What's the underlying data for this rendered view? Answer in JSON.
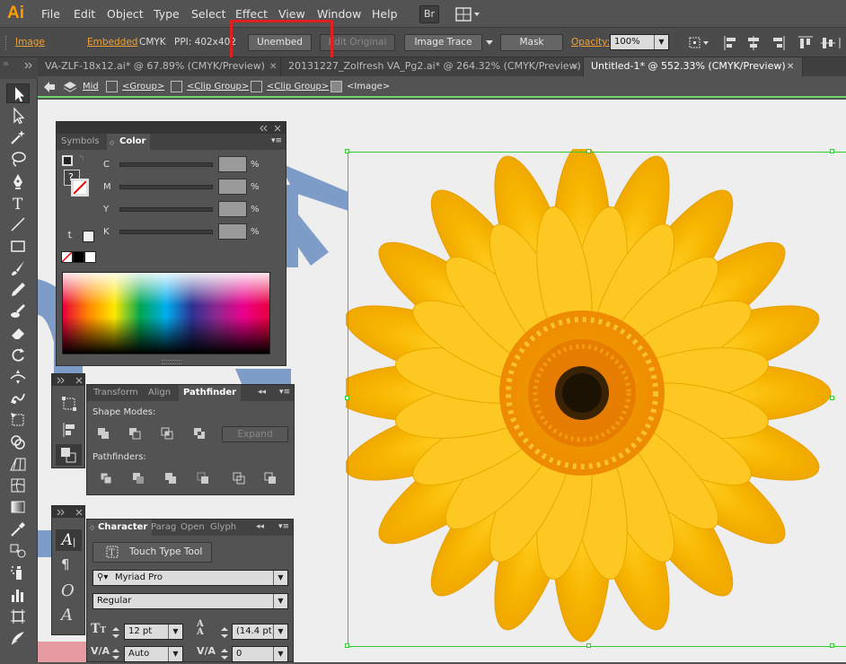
{
  "app": {
    "logo": "Ai"
  },
  "menu": [
    "File",
    "Edit",
    "Object",
    "Type",
    "Select",
    "Effect",
    "View",
    "Window",
    "Help"
  ],
  "menubar_buttons": {
    "bridge": "Br"
  },
  "control": {
    "object_type": "Image",
    "embedded": "Embedded",
    "color_mode": "CMYK",
    "ppi": "PPI: 402x402",
    "unembed": "Unembed",
    "edit_original": "Edit Original",
    "image_trace": "Image Trace",
    "mask": "Mask",
    "opacity_label": "Opacity:",
    "opacity_value": "100%"
  },
  "tabs": [
    {
      "label": "VA-ZLF-18x12.ai* @ 67.89% (CMYK/Preview)"
    },
    {
      "label": "20131227_Zolfresh VA_Pg2.ai* @ 264.32% (CMYK/Preview)"
    },
    {
      "label": "Untitled-1* @ 552.33% (CMYK/Preview)"
    }
  ],
  "breadcrumb": [
    "Mid",
    "<Group>",
    "<Clip Group>",
    "<Clip Group>",
    "<Image>"
  ],
  "color_panel": {
    "tabs": [
      "Symbols",
      "Color"
    ],
    "channels": [
      "C",
      "M",
      "Y",
      "K"
    ],
    "unknown_swatch": "?",
    "unit": "%"
  },
  "pathfinder_panel": {
    "tabs": [
      "Transform",
      "Align",
      "Pathfinder"
    ],
    "shape_modes": "Shape Modes:",
    "expand": "Expand",
    "pathfinders": "Pathfinders:"
  },
  "character_panel": {
    "tabs": [
      "Character",
      "Parag",
      "Open",
      "Glyph"
    ],
    "touch_type": "Touch Type Tool",
    "font_family": "Myriad Pro",
    "font_style": "Regular",
    "font_size": "12 pt",
    "leading": "(14.4 pt)",
    "kerning": "Auto",
    "tracking": "0"
  },
  "colors": {
    "accent_orange": "#f0a030",
    "highlight": "#e02020",
    "selection": "#33cc33",
    "flower": "#f6b800"
  }
}
